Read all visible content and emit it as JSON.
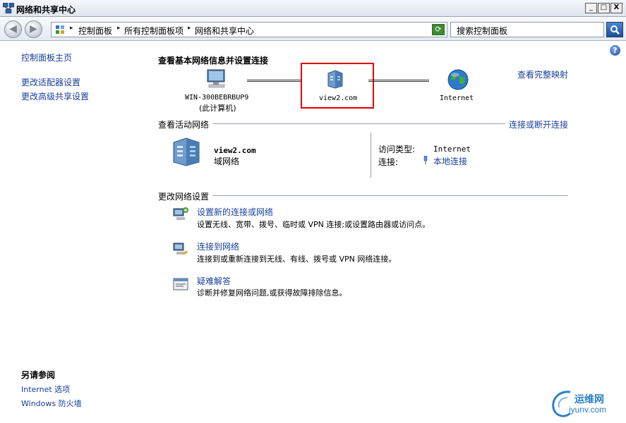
{
  "window": {
    "title": "网络和共享中心",
    "controls": [
      "_",
      "□",
      "X"
    ]
  },
  "address_bar": {
    "breadcrumbs": [
      "控制面板",
      "所有控制面板项",
      "网络和共享中心"
    ],
    "search_placeholder": "搜索控制面板"
  },
  "left_pane": {
    "links": [
      "控制面板主页",
      "更改适配器设置",
      "更改高级共享设置"
    ],
    "see_also_title": "另请参阅",
    "see_also": [
      "Internet 选项",
      "Windows 防火墙"
    ]
  },
  "main": {
    "heading": "查看基本网络信息并设置连接",
    "view_full_map": "查看完整映射",
    "map": {
      "computer_name": "WIN-300BEBRBUP9",
      "computer_note": "(此计算机)",
      "network_name": "view2.com",
      "internet_label": "Internet"
    },
    "active_networks": {
      "title": "查看活动网络",
      "connect_link": "连接或断开连接",
      "network_name": "view2.com",
      "network_type": "域网络",
      "access_type_label": "访问类型:",
      "access_type_value": "Internet",
      "connections_label": "连接:",
      "connections_value": "本地连接"
    },
    "change_settings": {
      "title": "更改网络设置",
      "tasks": [
        {
          "link": "设置新的连接或网络",
          "desc": "设置无线、宽带、拨号、临时或 VPN 连接;或设置路由器或访问点。",
          "icon": "setup-connection-icon"
        },
        {
          "link": "连接到网络",
          "desc": "连接到或重新连接到无线、有线、拨号或 VPN 网络连接。",
          "icon": "connect-network-icon"
        },
        {
          "link": "疑难解答",
          "desc": "诊断并修复网络问题,或获得故障排除信息。",
          "icon": "troubleshoot-icon"
        }
      ]
    }
  },
  "watermark": {
    "cn": "运维网",
    "en": "iyunv.com"
  },
  "colors": {
    "link": "#1a3f9a",
    "highlight": "#e00000"
  }
}
